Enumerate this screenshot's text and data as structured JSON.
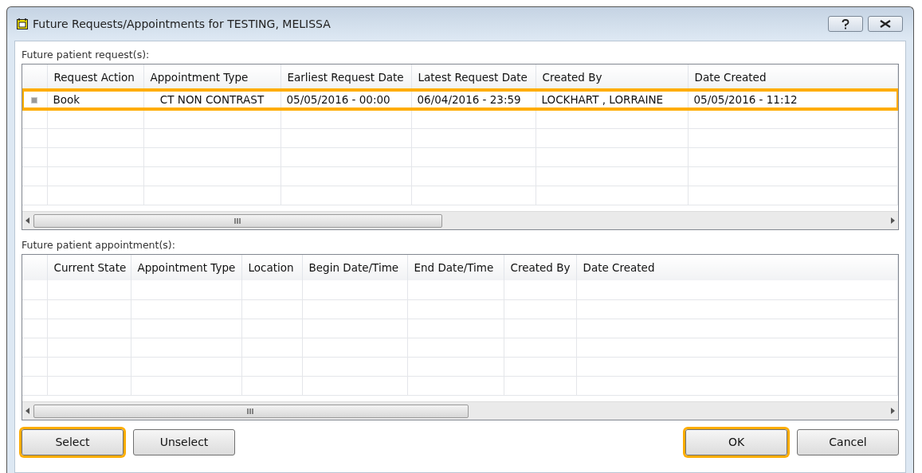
{
  "window": {
    "title": "Future Requests/Appointments for TESTING, MELISSA"
  },
  "requests": {
    "label": "Future patient request(s):",
    "columns": [
      "Request Action",
      "Appointment Type",
      "Earliest Request Date",
      "Latest Request Date",
      "Created By",
      "Date Created"
    ],
    "rows": [
      {
        "cells": [
          "Book",
          "CT NON CONTRAST",
          "05/05/2016 - 00:00",
          "06/04/2016 - 23:59",
          "LOCKHART , LORRAINE",
          "05/05/2016 - 11:12"
        ],
        "selected": true,
        "highlighted": true
      }
    ]
  },
  "appointments": {
    "label": "Future patient appointment(s):",
    "columns": [
      "Current State",
      "Appointment Type",
      "Location",
      "Begin Date/Time",
      "End Date/Time",
      "Created By",
      "Date Created"
    ]
  },
  "buttons": [
    {
      "label": "Select",
      "highlighted": true
    },
    {
      "label": "Unselect",
      "highlighted": false
    },
    {
      "label": "OK",
      "highlighted": true
    },
    {
      "label": "Cancel",
      "highlighted": false
    }
  ]
}
